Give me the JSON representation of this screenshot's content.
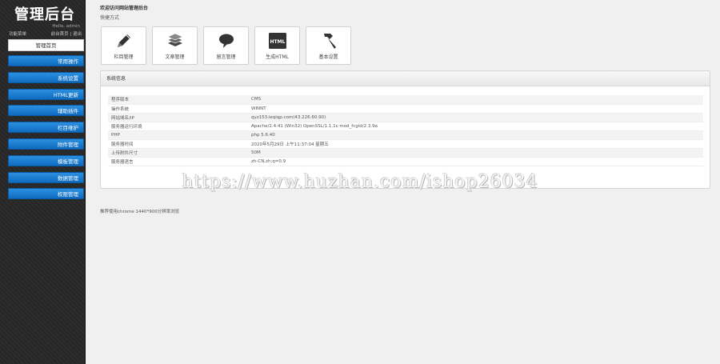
{
  "sidebar": {
    "brand": "管理后台",
    "hello": "Hello, admin",
    "func_label": "功能菜单",
    "link_home": "前台首页",
    "link_sep": "|",
    "link_logout": "退出",
    "home_item": "管理首页",
    "items": [
      {
        "label": "常用操作"
      },
      {
        "label": "系统设置"
      },
      {
        "label": "HTML更新"
      },
      {
        "label": "辅助插件"
      },
      {
        "label": "栏目维护"
      },
      {
        "label": "附件管理"
      },
      {
        "label": "模板管理"
      },
      {
        "label": "数据管理"
      },
      {
        "label": "权限管理"
      }
    ]
  },
  "main": {
    "welcome": "欢迎访问网站管理后台",
    "quick_title": "快捷方式",
    "tiles": [
      {
        "label": "栏目管理",
        "icon": "pencil-icon"
      },
      {
        "label": "文章管理",
        "icon": "document-stack-icon"
      },
      {
        "label": "留言管理",
        "icon": "speech-bubble-icon"
      },
      {
        "label": "生成HTML",
        "icon": "html-icon",
        "icon_text": "HTML"
      },
      {
        "label": "基本设置",
        "icon": "hammer-icon"
      }
    ],
    "sysinfo": {
      "title": "系统信息",
      "rows": [
        {
          "key": "程序版本",
          "value": "CMS"
        },
        {
          "key": "操作系统",
          "value": "WINNT"
        },
        {
          "key": "网站域名/IP",
          "value": "qyz153.ieqiqp.com(43.226.60.90)"
        },
        {
          "key": "服务器运行环境",
          "value": "Apache/2.4.41 (Win32) OpenSSL/1.1.1c mod_fcgid/2.3.9a"
        },
        {
          "key": "PHP",
          "value": "php 5.6.40"
        },
        {
          "key": "服务器时间",
          "value": "2020年5月29日 上午11:37:04 星期五"
        },
        {
          "key": "上传附件尺寸",
          "value": "50M"
        },
        {
          "key": "服务器语言",
          "value": "zh-CN,zh;q=0.9"
        }
      ]
    },
    "footer": "推荐使用chrome 1440*900分辨率浏览"
  },
  "watermark": "https://www.huzhan.com/ishop26034"
}
